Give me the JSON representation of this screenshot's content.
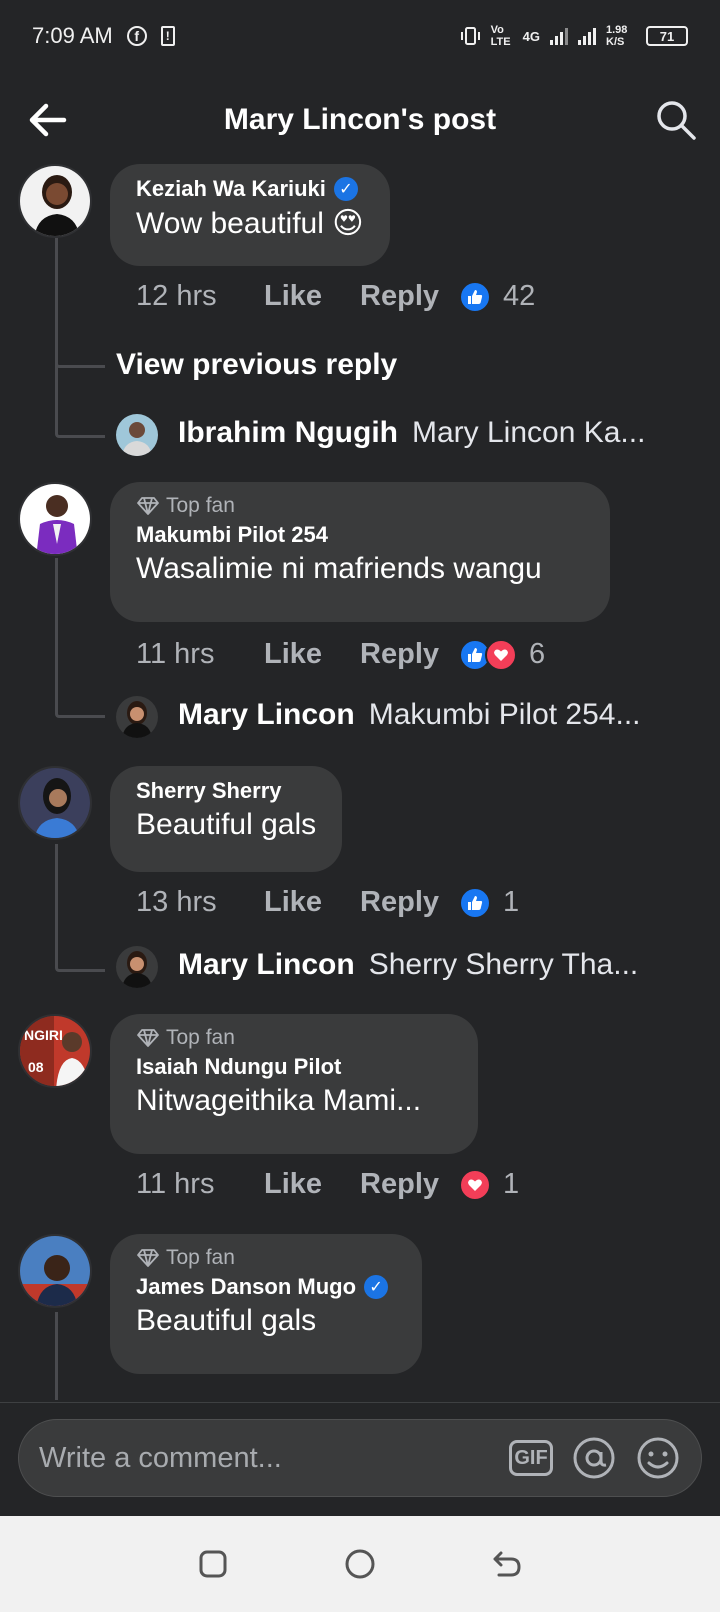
{
  "status_bar": {
    "time": "7:09 AM",
    "facebook_icon": "facebook-icon",
    "alert_icon": "alert-icon",
    "vibrate_icon": "vibrate-icon",
    "volte": "Vo LTE",
    "network": "4G",
    "speed": "1.98 K/S",
    "battery": "71"
  },
  "header": {
    "title": "Mary Lincon's post",
    "back_icon": "back-arrow-icon",
    "search_icon": "search-icon"
  },
  "comments": [
    {
      "author": "Keziah Wa Kariuki",
      "verified": true,
      "top_fan": false,
      "text": "Wow beautiful 😍",
      "time": "12 hrs",
      "like_label": "Like",
      "reply_label": "Reply",
      "reactions": [
        "like"
      ],
      "reaction_count": "42",
      "view_previous": "View previous reply",
      "reply": {
        "author": "Ibrahim Ngugih",
        "preview": "Mary Lincon Ka..."
      },
      "avatar_color": "#f2f2f2"
    },
    {
      "author": "Makumbi Pilot 254",
      "verified": false,
      "top_fan": true,
      "badge": "Top fan",
      "text": "Wasalimie ni mafriends wangu",
      "time": "11 hrs",
      "like_label": "Like",
      "reply_label": "Reply",
      "reactions": [
        "like",
        "love"
      ],
      "reaction_count": "6",
      "reply": {
        "author": "Mary Lincon",
        "preview": "Makumbi Pilot 254..."
      },
      "avatar_color": "#ffffff"
    },
    {
      "author": "Sherry Sherry",
      "verified": false,
      "top_fan": false,
      "text": "Beautiful gals",
      "time": "13 hrs",
      "like_label": "Like",
      "reply_label": "Reply",
      "reactions": [
        "like"
      ],
      "reaction_count": "1",
      "reply": {
        "author": "Mary Lincon",
        "preview": "Sherry Sherry Tha..."
      },
      "avatar_color": "#3b3f5c"
    },
    {
      "author": "Isaiah Ndungu Pilot",
      "verified": false,
      "top_fan": true,
      "badge": "Top fan",
      "text": "Nitwageithika Mami...",
      "time": "11 hrs",
      "like_label": "Like",
      "reply_label": "Reply",
      "reactions": [
        "love"
      ],
      "reaction_count": "1",
      "avatar_color": "#c0392b"
    },
    {
      "author": "James Danson Mugo",
      "verified": true,
      "top_fan": true,
      "badge": "Top fan",
      "text": "Beautiful gals",
      "avatar_color": "#4a7fc1"
    }
  ],
  "composer": {
    "placeholder": "Write a comment...",
    "gif_label": "GIF",
    "mention_icon": "at-sign-icon",
    "emoji_icon": "emoji-icon"
  },
  "navbar": {
    "recents_icon": "recents-icon",
    "home_icon": "home-icon",
    "back_icon": "nav-back-icon"
  }
}
